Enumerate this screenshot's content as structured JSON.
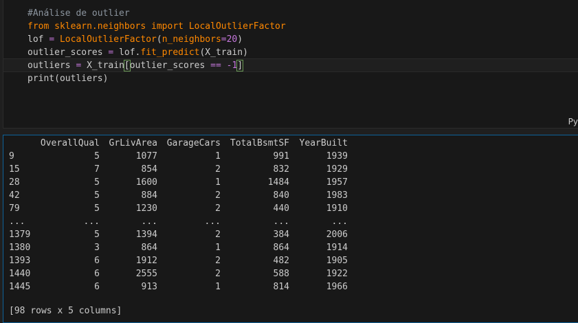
{
  "code": {
    "lines": [
      [
        {
          "t": "#Análise de outlier",
          "c": "comment"
        }
      ],
      [
        {
          "t": "from",
          "c": "kw"
        },
        {
          "t": " sklearn.neighbors ",
          "c": "mod"
        },
        {
          "t": "import",
          "c": "kw"
        },
        {
          "t": " LocalOutlierFactor",
          "c": "mod"
        }
      ],
      [
        {
          "t": "lof ",
          "c": "plain"
        },
        {
          "t": "=",
          "c": "op"
        },
        {
          "t": " LocalOutlierFactor",
          "c": "func"
        },
        {
          "t": "(",
          "c": "plain"
        },
        {
          "t": "n_neighbors",
          "c": "param"
        },
        {
          "t": "=",
          "c": "op"
        },
        {
          "t": "20",
          "c": "num"
        },
        {
          "t": ")",
          "c": "plain"
        }
      ],
      [
        {
          "t": "outlier_scores ",
          "c": "plain"
        },
        {
          "t": "=",
          "c": "op"
        },
        {
          "t": " lof.",
          "c": "plain"
        },
        {
          "t": "fit_predict",
          "c": "func"
        },
        {
          "t": "(X_train)",
          "c": "plain"
        }
      ],
      [
        {
          "t": "outliers ",
          "c": "plain"
        },
        {
          "t": "=",
          "c": "op"
        },
        {
          "t": " X_train",
          "c": "plain"
        },
        {
          "t": "[",
          "c": "bracket"
        },
        {
          "t": "outlier_scores ",
          "c": "plain"
        },
        {
          "t": "==",
          "c": "op"
        },
        {
          "t": " ",
          "c": "plain"
        },
        {
          "t": "-1",
          "c": "num"
        },
        {
          "t": "]",
          "c": "bracket"
        }
      ],
      [
        {
          "t": "print",
          "c": "builtin"
        },
        {
          "t": "(outliers)",
          "c": "plain"
        }
      ]
    ],
    "language_label": "Py"
  },
  "output": {
    "headers": [
      "",
      "OverallQual",
      "GrLivArea",
      "GarageCars",
      "TotalBsmtSF",
      "YearBuilt"
    ],
    "rows": [
      [
        "9",
        "5",
        "1077",
        "1",
        "991",
        "1939"
      ],
      [
        "15",
        "7",
        "854",
        "2",
        "832",
        "1929"
      ],
      [
        "28",
        "5",
        "1600",
        "1",
        "1484",
        "1957"
      ],
      [
        "42",
        "5",
        "884",
        "2",
        "840",
        "1983"
      ],
      [
        "79",
        "5",
        "1230",
        "2",
        "440",
        "1910"
      ],
      [
        "...",
        "...",
        "...",
        "...",
        "...",
        "..."
      ],
      [
        "1379",
        "5",
        "1394",
        "2",
        "384",
        "2006"
      ],
      [
        "1380",
        "3",
        "864",
        "1",
        "864",
        "1914"
      ],
      [
        "1393",
        "6",
        "1912",
        "2",
        "482",
        "1905"
      ],
      [
        "1440",
        "6",
        "2555",
        "2",
        "588",
        "1922"
      ],
      [
        "1445",
        "6",
        "913",
        "1",
        "814",
        "1966"
      ]
    ],
    "summary": "[98 rows x 5 columns]"
  }
}
